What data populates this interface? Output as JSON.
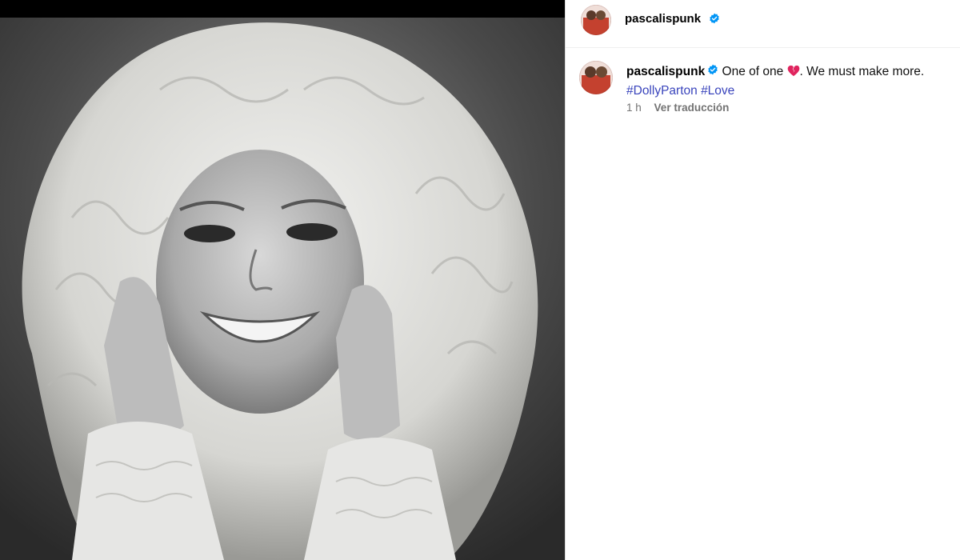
{
  "post": {
    "username": "pascalispunk",
    "verified": true,
    "image_alt": "Black and white portrait of Dolly Parton smiling with hands on cheeks"
  },
  "caption": {
    "username": "pascalispunk",
    "text_before_emoji": "One of one",
    "emoji": "broken-heart-icon",
    "text_after_emoji": ". We must make more.",
    "hashtags": [
      "#DollyParton",
      "#Love"
    ]
  },
  "meta": {
    "time": "1 h",
    "translate_label": "Ver traducción"
  },
  "colors": {
    "verified_badge": "#0095f6",
    "hashtag": "#3944bc",
    "muted": "#737373",
    "broken_heart": "#e0245e"
  }
}
